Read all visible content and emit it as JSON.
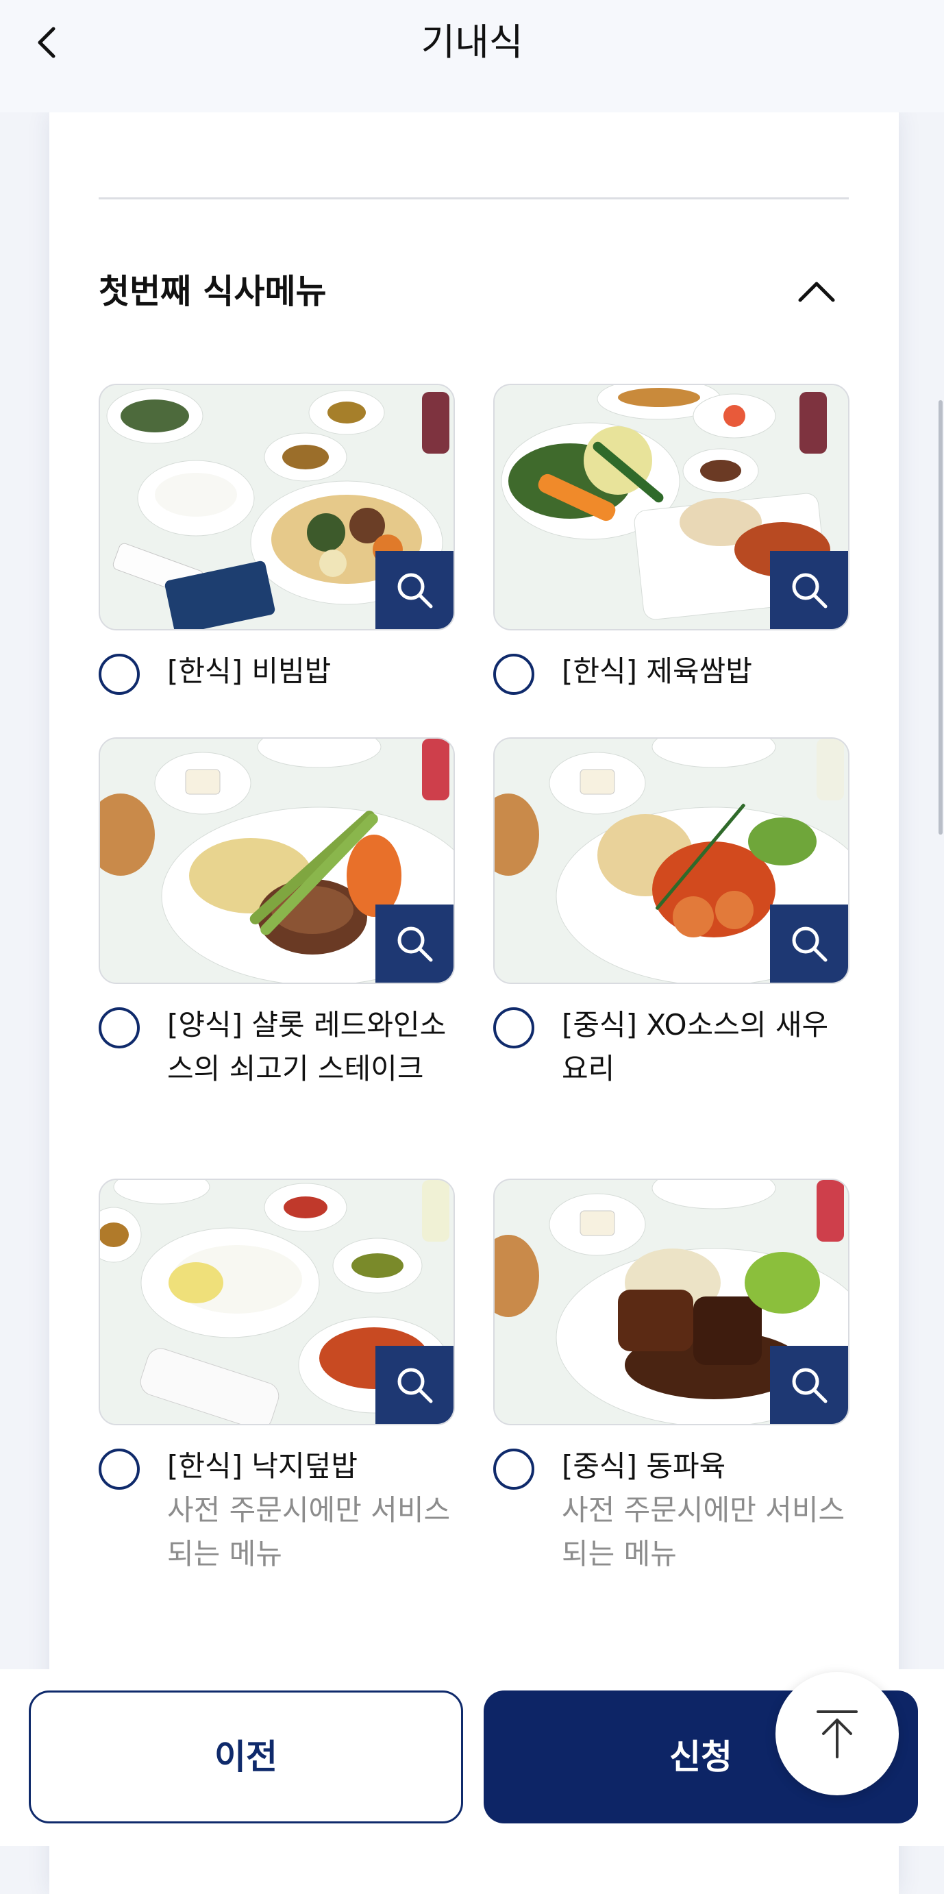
{
  "header": {
    "title": "기내식"
  },
  "section": {
    "title": "첫번째 식사메뉴"
  },
  "menu_items": [
    {
      "label": "[한식] 비빔밥",
      "note": ""
    },
    {
      "label": "[한식] 제육쌈밥",
      "note": ""
    },
    {
      "label": "[양식] 샬롯 레드와인소스의 쇠고기 스테이크",
      "note": ""
    },
    {
      "label": "[중식] XO소스의 새우 요리",
      "note": ""
    },
    {
      "label": "[한식] 낙지덮밥",
      "note": "사전 주문시에만 서비스되는 메뉴"
    },
    {
      "label": "[중식] 동파육",
      "note": "사전 주문시에만 서비스되는 메뉴"
    }
  ],
  "footer": {
    "prev_label": "이전",
    "apply_label": "신청"
  },
  "colors": {
    "primary": "#0d2566",
    "zoom": "#1e3873",
    "note": "#8c8c8c"
  },
  "icons": [
    "back-arrow-icon",
    "chevron-up-icon",
    "search-icon",
    "arrow-up-icon"
  ]
}
